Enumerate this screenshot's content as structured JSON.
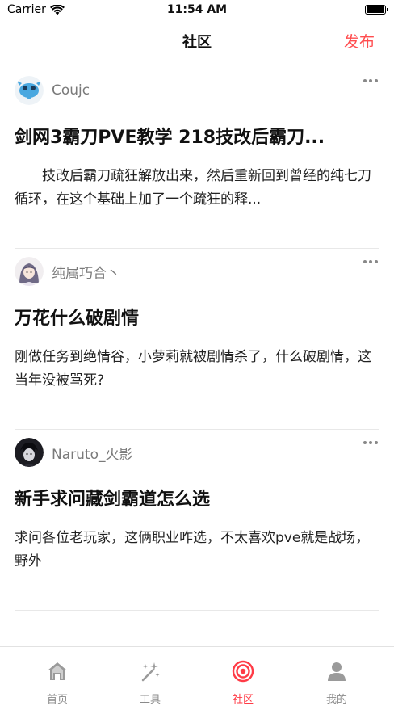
{
  "status_bar": {
    "carrier": "Carrier",
    "time": "11:54 AM"
  },
  "nav": {
    "title": "社区",
    "publish_label": "发布"
  },
  "posts": [
    {
      "author": "Coujc",
      "title": "剑网3霸刀PVE教学 218技改后霸刀...",
      "body": "技改后霸刀疏狂解放出来，然后重新回到曾经的纯七刀循环，在这个基础上加了一个疏狂的释..."
    },
    {
      "author": "纯属巧合丶",
      "title": "万花什么破剧情",
      "body": "刚做任务到绝情谷，小萝莉就被剧情杀了，什么破剧情，这当年没被骂死?"
    },
    {
      "author": "Naruto_火影",
      "title": "新手求问藏剑霸道怎么选",
      "body": "求问各位老玩家，这俩职业咋选，不太喜欢pve就是战场，野外"
    }
  ],
  "tabs": [
    {
      "label": "首页",
      "icon": "home-icon"
    },
    {
      "label": "工具",
      "icon": "magic-wand-icon"
    },
    {
      "label": "社区",
      "icon": "target-icon",
      "active": true
    },
    {
      "label": "我的",
      "icon": "person-icon"
    }
  ],
  "colors": {
    "accent": "#ff3b46",
    "publish": "#ff4d4f",
    "muted": "#8a8a8a"
  }
}
